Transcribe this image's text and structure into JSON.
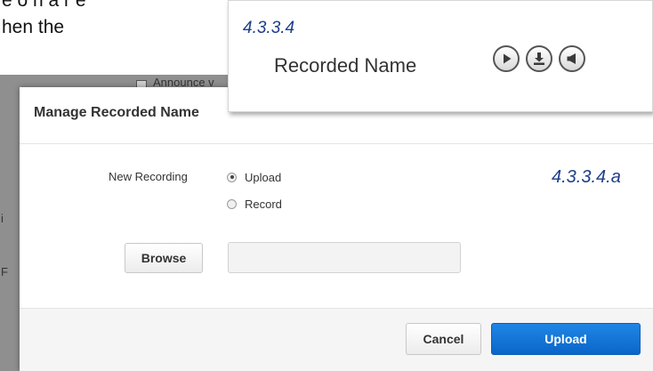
{
  "document": {
    "line1_fragment": "e o n a r e",
    "line2_fragment": "hen the"
  },
  "behind_page": {
    "checkbox_label": "Announce v",
    "edge_chars": [
      "i",
      "F"
    ]
  },
  "callout": {
    "reference": "4.3.3.4",
    "label": "Recorded Name",
    "icons": [
      "play-icon",
      "download-icon",
      "speaker-icon"
    ]
  },
  "modal": {
    "title": "Manage Recorded Name",
    "reference": "4.3.3.4.a",
    "new_recording_label": "New Recording",
    "options": [
      {
        "label": "Upload",
        "selected": true
      },
      {
        "label": "Record",
        "selected": false
      }
    ],
    "browse_label": "Browse",
    "file_value": "",
    "cancel_label": "Cancel",
    "upload_label": "Upload"
  },
  "colors": {
    "reference_text": "#1f3f8a",
    "primary_button": "#0a66c8",
    "backdrop": "#8f8f8f"
  }
}
